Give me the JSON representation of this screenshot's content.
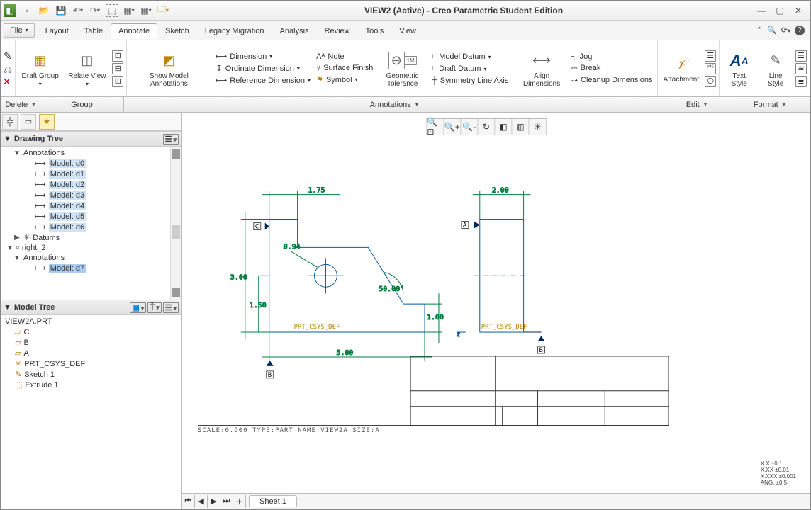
{
  "title": "VIEW2 (Active) - Creo Parametric Student Edition",
  "file_menu": "File",
  "tabs": [
    "Layout",
    "Table",
    "Annotate",
    "Sketch",
    "Legacy Migration",
    "Analysis",
    "Review",
    "Tools",
    "View"
  ],
  "active_tab": "Annotate",
  "ribbon": {
    "delete": "Delete",
    "draft_group": "Draft\nGroup",
    "relate_view": "Relate\nView",
    "show_model": "Show Model\nAnnotations",
    "dimension": "Dimension",
    "ordinate": "Ordinate Dimension",
    "reference": "Reference Dimension",
    "note": "Note",
    "surface": "Surface Finish",
    "symbol": "Symbol",
    "geo_tol": "Geometric\nTolerance",
    "model_datum": "Model Datum",
    "draft_datum": "Draft Datum",
    "sym_axis": "Symmetry Line Axis",
    "align_dim": "Align\nDimensions",
    "jog": "Jog",
    "break": "Break",
    "cleanup": "Cleanup Dimensions",
    "attachment": "Attachment",
    "text_style": "Text\nStyle",
    "line_style": "Line\nStyle"
  },
  "sub": {
    "delete": "Delete",
    "group": "Group",
    "annotations": "Annotations",
    "edit": "Edit",
    "format": "Format"
  },
  "drawing_tree": {
    "title": "Drawing Tree",
    "annotations": "Annotations",
    "items": [
      "Model: d0",
      "Model: d1",
      "Model: d2",
      "Model: d3",
      "Model: d4",
      "Model: d5",
      "Model: d6"
    ],
    "datums": "Datums",
    "right2": "right_2",
    "annotations2": "Annotations",
    "item7": "Model: d7"
  },
  "model_tree": {
    "title": "Model Tree",
    "root": "VIEW2A.PRT",
    "items": [
      {
        "icon": "plane",
        "label": "C"
      },
      {
        "icon": "plane",
        "label": "B"
      },
      {
        "icon": "plane",
        "label": "A"
      },
      {
        "icon": "csys",
        "label": "PRT_CSYS_DEF"
      },
      {
        "icon": "sketch",
        "label": "Sketch 1"
      },
      {
        "icon": "extrude",
        "label": "Extrude 1"
      }
    ]
  },
  "drawing": {
    "dims": {
      "d175": "1.75",
      "d300": "3.00",
      "d150": "1.50",
      "d500": "5.00",
      "d100": "1.00",
      "d50": "50.00°",
      "d094": "Ø.94",
      "d200": "2.00"
    },
    "csys": "PRT_CSYS_DEF",
    "datum_a": "A",
    "datum_b": "B",
    "datum_c": "C"
  },
  "sheet_footer": "SCALE:0.500  TYPE:PART  NAME:VIEW2A  SIZE:A",
  "tol": [
    "X.X   ±0.1",
    "X.XX  ±0.01",
    "X.XXX ±0.001",
    "ANG.  ±0.5"
  ],
  "sheet_tab": "Sheet 1"
}
